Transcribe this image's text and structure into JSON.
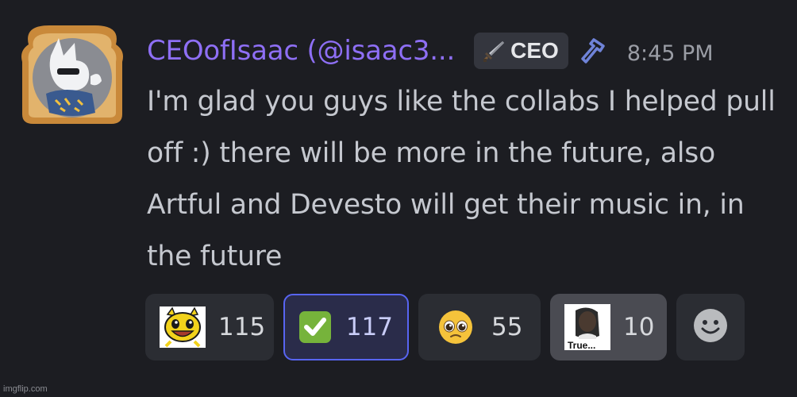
{
  "message": {
    "author_display": "CEOofIsaac (@isaac3...",
    "role_label": "CEO",
    "role_icon": "sword-icon",
    "moderator_icon": "hammer-icon",
    "timestamp": "8:45 PM",
    "text": "I'm glad you guys like the collabs I helped pull off :) there will be more in the future, also Artful and Devesto will get their music in, in the future",
    "avatar": "toast-frame-avatar"
  },
  "reactions": [
    {
      "emoji": "happy-cat-emoji",
      "count": "115",
      "state": "default"
    },
    {
      "emoji": "green-check-emoji",
      "count": "117",
      "state": "active"
    },
    {
      "emoji": "pleading-face-emoji",
      "count": "55",
      "state": "default"
    },
    {
      "emoji": "true-meme-emoji",
      "emoji_text": "True...",
      "count": "10",
      "state": "highlighted"
    }
  ],
  "add_reaction_icon": "smiley-add-icon",
  "watermark": "imgflip.com",
  "colors": {
    "background": "#1c1d22",
    "username": "#8e6ff5",
    "active_border": "#5865f2",
    "hammer": "#6f83d8"
  }
}
